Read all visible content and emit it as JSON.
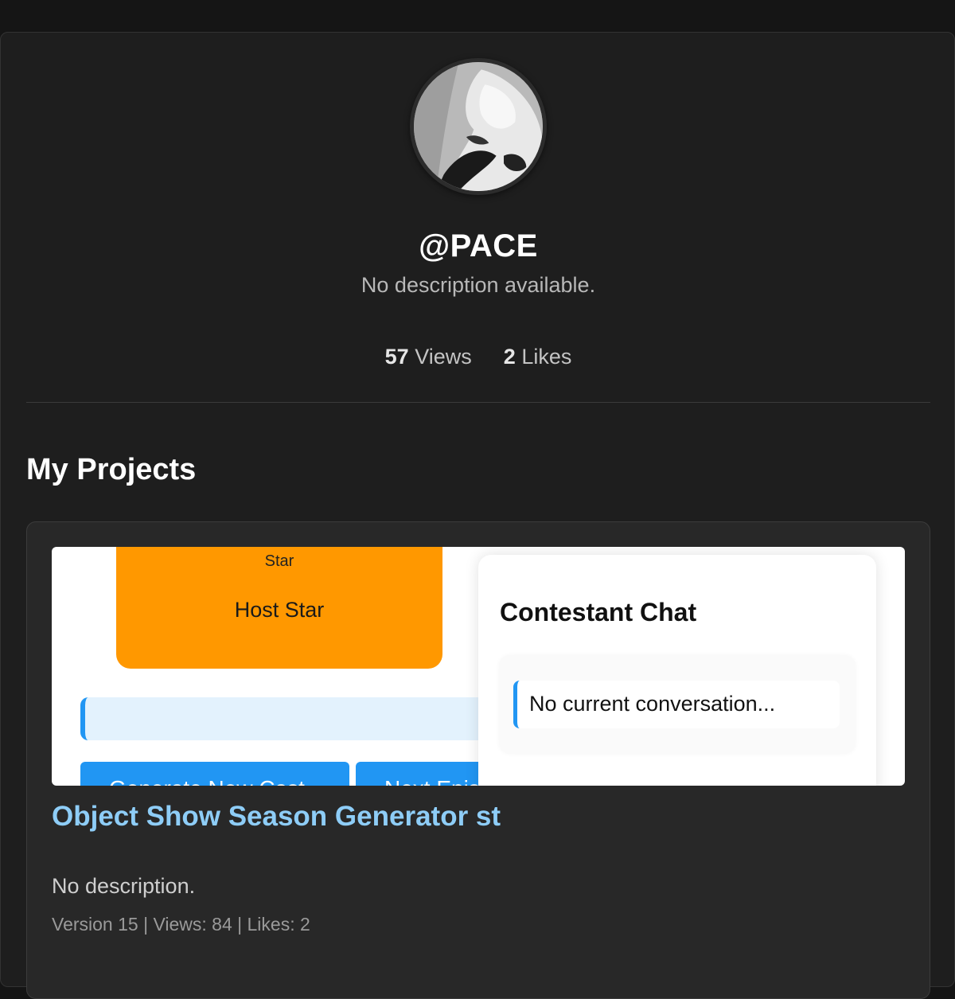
{
  "profile": {
    "username": "@PACE",
    "description": "No description available.",
    "stats": {
      "views_count": "57",
      "views_label": "Views",
      "likes_count": "2",
      "likes_label": "Likes"
    }
  },
  "projects_section": {
    "title": "My Projects",
    "projects": [
      {
        "title": "Object Show Season Generator st",
        "description": "No description.",
        "meta": "Version 15 | Views: 84 | Likes: 2",
        "thumbnail": {
          "sun_label": "Star",
          "host_label": "Host Star",
          "generate_button": "Generate New Cast",
          "next_button": "Next Episode",
          "chat_title": "Contestant Chat",
          "chat_message": "No current conversation..."
        }
      }
    ]
  },
  "colors": {
    "page_bg": "#151515",
    "card_bg": "#1e1e1e",
    "project_card_bg": "#282828",
    "project_title": "#8ecdf7",
    "accent_blue": "#2196f3",
    "host_orange": "#ff9800",
    "sun_yellow": "#ffd600"
  }
}
